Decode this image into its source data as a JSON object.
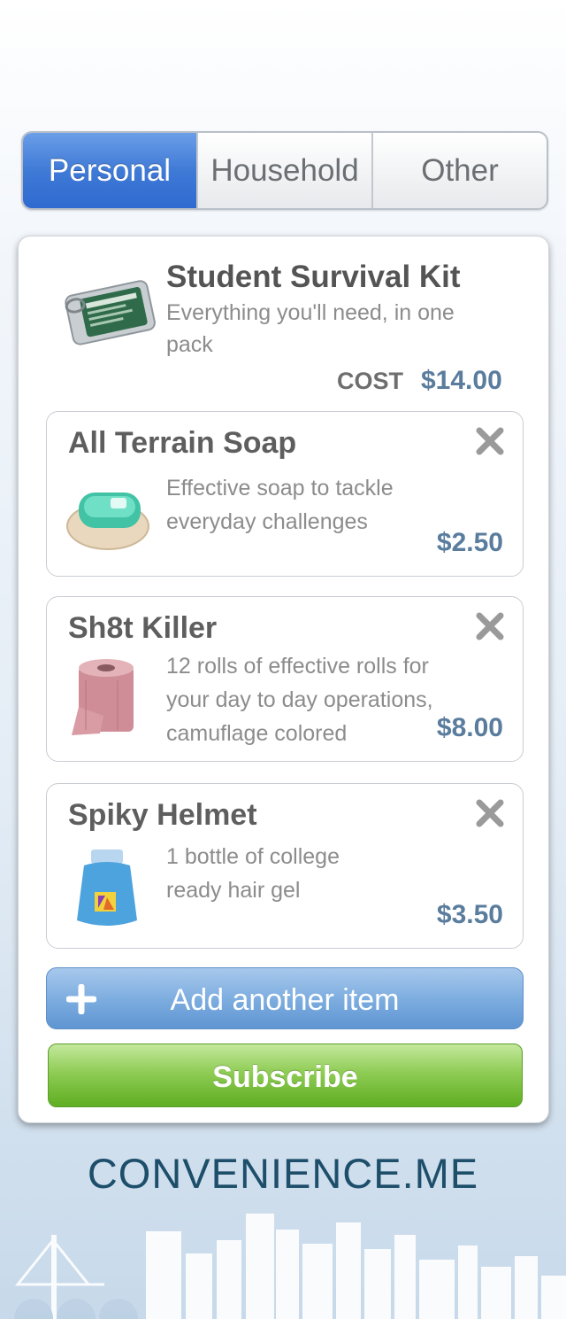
{
  "tabs": [
    {
      "label": "Personal",
      "active": true
    },
    {
      "label": "Household",
      "active": false
    },
    {
      "label": "Other",
      "active": false
    }
  ],
  "kit": {
    "title": "Student Survival Kit",
    "description": "Everything you'll need, in one pack",
    "cost_label": "COST",
    "cost_value": "$14.00"
  },
  "items": [
    {
      "title": "All Terrain Soap",
      "description_lines": [
        "Effective soap to tackle",
        "everyday challenges"
      ],
      "price": "$2.50",
      "image": "soap-bar"
    },
    {
      "title": "Sh8t Killer",
      "description_lines": [
        "12 rolls of effective rolls for",
        "your day to day operations,",
        "camuflage colored"
      ],
      "price": "$8.00",
      "image": "toilet-paper-roll"
    },
    {
      "title": "Spiky Helmet",
      "description_lines": [
        "1 bottle of college",
        "ready hair gel"
      ],
      "price": "$3.50",
      "image": "hair-gel-bottle"
    }
  ],
  "add_button": {
    "label": "Add another item",
    "icon": "plus-icon"
  },
  "subscribe_button": {
    "label": "Subscribe"
  },
  "brand": "CONVENIENCE.ME",
  "colors": {
    "accent_blue": "#3f7ad6",
    "price_blue": "#5a7c9d",
    "subscribe_green": "#6cb52e",
    "brand_navy": "#1d4e6a"
  }
}
